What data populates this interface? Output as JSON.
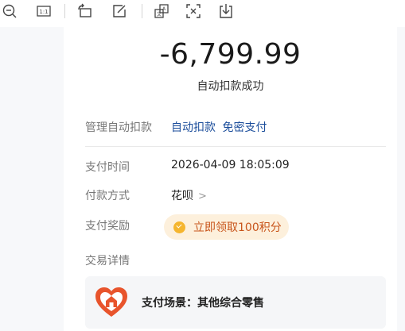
{
  "toolbar": {
    "icons": [
      "zoom-out-icon",
      "actual-size-icon",
      "rotate-icon",
      "edit-icon",
      "extract-text-icon",
      "screenshot-icon",
      "download-icon"
    ]
  },
  "transaction": {
    "amount": "-6,799.99",
    "status": "自动扣款成功"
  },
  "rows": {
    "manage_label": "管理自动扣款",
    "manage_link_1": "自动扣款",
    "manage_link_2": "免密支付",
    "time_label": "支付时间",
    "time_value": "2026-04-09 18:05:09",
    "method_label": "付款方式",
    "method_value": "花呗",
    "reward_label": "支付奖励",
    "reward_button": "立即领取100积分",
    "details_label": "交易详情"
  },
  "scene": {
    "text": "支付场景：其他综合零售"
  },
  "colors": {
    "link": "#1b4d9b",
    "reward_text": "#c8541a",
    "reward_bg": "#fdf0dc",
    "coin": "#f5b52e",
    "scene_icon": "#e8542c"
  }
}
